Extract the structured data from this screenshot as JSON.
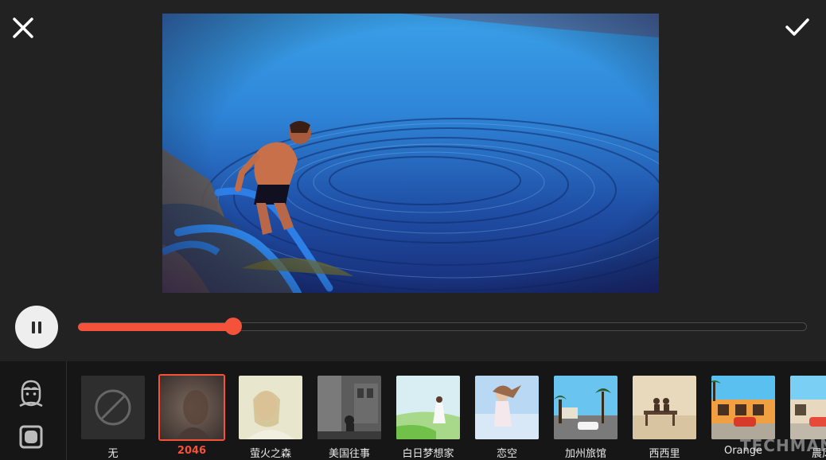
{
  "header": {
    "close_icon": "close-icon",
    "confirm_icon": "checkmark-icon"
  },
  "preview": {
    "description_icon": "video-frame"
  },
  "player": {
    "state": "playing",
    "play_pause_icon": "pause-icon",
    "progress": 0.213
  },
  "side_tools": [
    {
      "icon": "face-icon"
    },
    {
      "icon": "square-shape-icon"
    }
  ],
  "filters": {
    "selected_index": 1,
    "items": [
      {
        "label": "无"
      },
      {
        "label": "2046"
      },
      {
        "label": "萤火之森"
      },
      {
        "label": "美国往事"
      },
      {
        "label": "白日梦想家"
      },
      {
        "label": "恋空"
      },
      {
        "label": "加州旅馆"
      },
      {
        "label": "西西里"
      },
      {
        "label": "Orange"
      },
      {
        "label": "晨风"
      }
    ]
  },
  "watermark": "TECHMAN",
  "colors": {
    "accent": "#f4523a",
    "background": "#222222",
    "panel": "#161616"
  }
}
